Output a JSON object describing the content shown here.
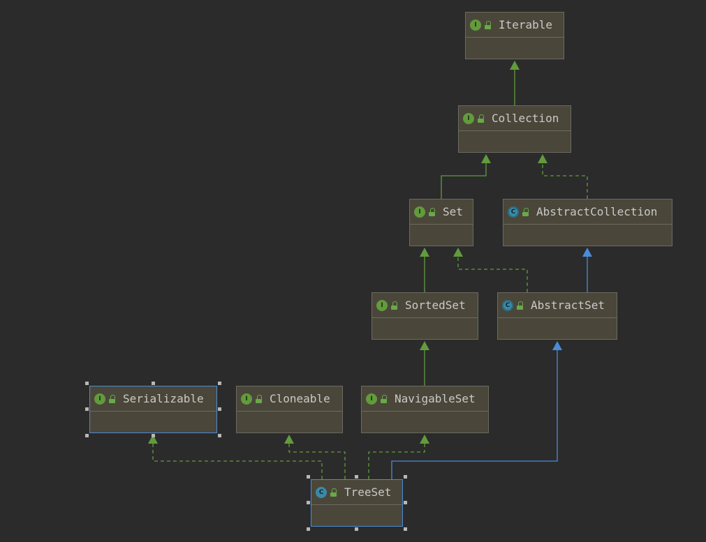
{
  "nodes": [
    {
      "id": "Iterable",
      "name": "Iterable",
      "kind": "interface",
      "badge": "I",
      "selected": false
    },
    {
      "id": "Collection",
      "name": "Collection",
      "kind": "interface",
      "badge": "I",
      "selected": false
    },
    {
      "id": "Set",
      "name": "Set",
      "kind": "interface",
      "badge": "I",
      "selected": false
    },
    {
      "id": "AbstractCollection",
      "name": "AbstractCollection",
      "kind": "abstract-class",
      "badge": "C",
      "selected": false
    },
    {
      "id": "SortedSet",
      "name": "SortedSet",
      "kind": "interface",
      "badge": "I",
      "selected": false
    },
    {
      "id": "AbstractSet",
      "name": "AbstractSet",
      "kind": "abstract-class",
      "badge": "C",
      "selected": false
    },
    {
      "id": "Serializable",
      "name": "Serializable",
      "kind": "interface",
      "badge": "I",
      "selected": true
    },
    {
      "id": "Cloneable",
      "name": "Cloneable",
      "kind": "interface",
      "badge": "I",
      "selected": false
    },
    {
      "id": "NavigableSet",
      "name": "NavigableSet",
      "kind": "interface",
      "badge": "I",
      "selected": false
    },
    {
      "id": "TreeSet",
      "name": "TreeSet",
      "kind": "class",
      "badge": "C",
      "selected": true
    }
  ],
  "edges": [
    {
      "from": "Collection",
      "to": "Iterable",
      "relation": "extends"
    },
    {
      "from": "Set",
      "to": "Collection",
      "relation": "extends"
    },
    {
      "from": "AbstractCollection",
      "to": "Collection",
      "relation": "implements"
    },
    {
      "from": "SortedSet",
      "to": "Set",
      "relation": "extends"
    },
    {
      "from": "AbstractSet",
      "to": "Set",
      "relation": "implements"
    },
    {
      "from": "AbstractSet",
      "to": "AbstractCollection",
      "relation": "class-extends"
    },
    {
      "from": "NavigableSet",
      "to": "SortedSet",
      "relation": "extends"
    },
    {
      "from": "TreeSet",
      "to": "Serializable",
      "relation": "implements"
    },
    {
      "from": "TreeSet",
      "to": "Cloneable",
      "relation": "implements"
    },
    {
      "from": "TreeSet",
      "to": "NavigableSet",
      "relation": "implements"
    },
    {
      "from": "TreeSet",
      "to": "AbstractSet",
      "relation": "class-extends"
    }
  ],
  "colors": {
    "background": "#2b2b2b",
    "node_fill": "#4a473a",
    "interface_edge": "#629b3c",
    "class_edge": "#4a8cd8",
    "selection": "#4a8cd8"
  }
}
